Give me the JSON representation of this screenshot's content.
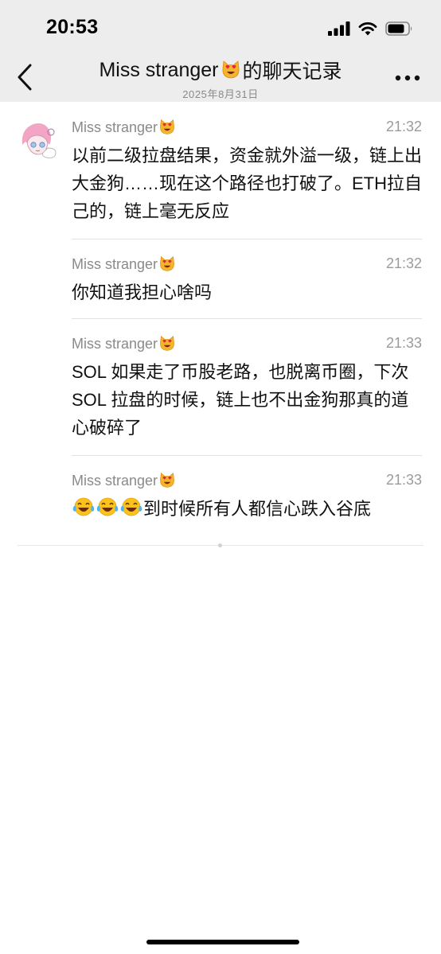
{
  "status_bar": {
    "time": "20:53"
  },
  "nav": {
    "title_name": "Miss stranger",
    "title_suffix": "的聊天记录",
    "subtitle": "2025年8月31日"
  },
  "messages": [
    {
      "sender": "Miss stranger",
      "time": "21:32",
      "text": "以前二级拉盘结果，资金就外溢一级，链上出大金狗……现在这个路径也打破了。ETH拉自己的，链上毫无反应"
    },
    {
      "sender": "Miss stranger",
      "time": "21:32",
      "text": "你知道我担心啥吗"
    },
    {
      "sender": "Miss stranger",
      "time": "21:33",
      "text": "SOL 如果走了币股老路，也脱离币圈，下次 SOL 拉盘的时候，链上也不出金狗那真的道心破碎了"
    },
    {
      "sender": "Miss stranger",
      "time": "21:33",
      "text": "到时候所有人都信心跌入谷底"
    }
  ],
  "icons": {
    "sender_emoji": "heart-eyes-cat",
    "laugh_emoji": "tears-of-joy",
    "back": "chevron-left",
    "more": "ellipsis"
  },
  "colors": {
    "nav_bg": "#ededed",
    "meta_gray": "#8a8a8a",
    "divider": "#e2e2e2"
  }
}
